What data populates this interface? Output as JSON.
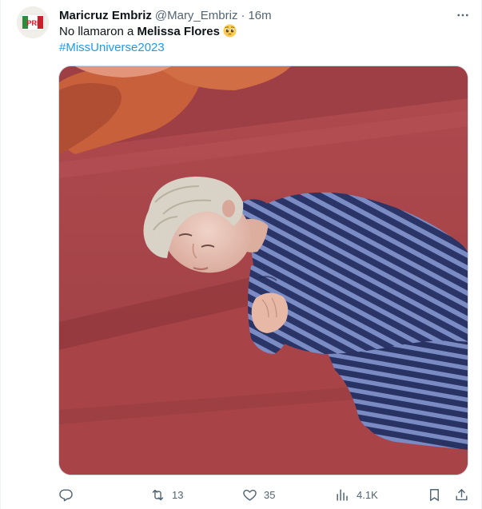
{
  "tweet": {
    "author": {
      "name": "Maricruz Embriz",
      "handle": "@Mary_Embriz",
      "separator": "·",
      "time": "16m",
      "avatar_icon": "pri-logo-avatar",
      "avatar_text": "PRI"
    },
    "text": {
      "prefix": "No llamaron a ",
      "bold": "Melissa Flores",
      "emoji": "pleading-face-emoji",
      "hashtag": "#MissUniverse2023"
    },
    "media": {
      "colors": {
        "floor": "#a8454a",
        "stripe_dark": "#2a3466",
        "stripe_light": "#7b8bc4",
        "hair": "#d8d3c6",
        "pillow": "#c8603c"
      }
    },
    "actions": {
      "reply": {
        "icon": "reply-icon",
        "count": ""
      },
      "retweet": {
        "icon": "retweet-icon",
        "count": "13"
      },
      "like": {
        "icon": "heart-icon",
        "count": "35"
      },
      "views": {
        "icon": "views-icon",
        "count": "4.1K"
      },
      "bookmark": {
        "icon": "bookmark-icon"
      },
      "share": {
        "icon": "share-icon"
      }
    },
    "colors": {
      "text": "#0f1419",
      "secondary": "#536471",
      "link": "#1d9bf0"
    }
  }
}
